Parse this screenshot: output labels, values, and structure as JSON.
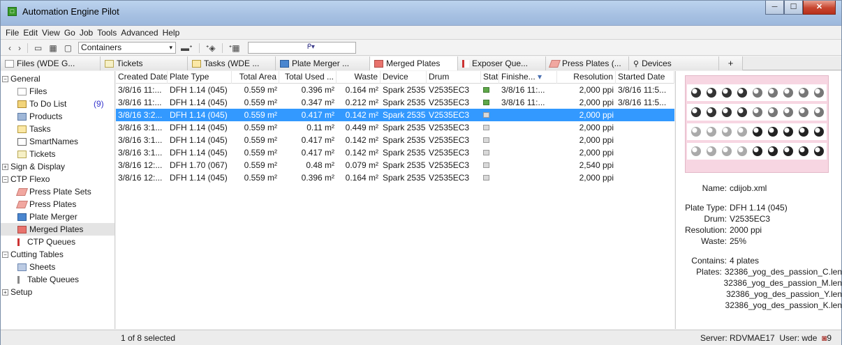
{
  "window": {
    "title": "Automation Engine Pilot",
    "app_icon_glyph": "□"
  },
  "window_buttons": {
    "minimize": "─",
    "maximize": "☐",
    "close": "✕"
  },
  "menubar": [
    "File",
    "Edit",
    "View",
    "Go",
    "Job",
    "Tools",
    "Advanced",
    "Help"
  ],
  "toolbar": {
    "back": "‹",
    "forward": "›",
    "view_list": "▭",
    "view_grid": "▦",
    "view_detail": "▢",
    "containers_label": "Containers",
    "dropdown_arrow": "▾",
    "action1": "▬ᐩ",
    "action2": "ᐩ◈",
    "action3": "ᐩ▦",
    "search_value": "",
    "search_icon": "ᑭ▾"
  },
  "tabs": [
    {
      "label": "Files (WDE G...",
      "icon": "files-icon"
    },
    {
      "label": "Tickets",
      "icon": "ticket-icon"
    },
    {
      "label": "Tasks (WDE ...",
      "icon": "task-icon"
    },
    {
      "label": "Plate Merger ...",
      "icon": "plate-merger-icon"
    },
    {
      "label": "Merged Plates",
      "icon": "merged-plates-icon"
    },
    {
      "label": "Exposer Que...",
      "icon": "exposer-queue-icon"
    },
    {
      "label": "Press Plates (...",
      "icon": "press-plates-icon"
    },
    {
      "label": "Devices",
      "icon": "device-icon"
    }
  ],
  "tab_plus": "+",
  "sidebar": {
    "expanders": {
      "open": "−",
      "closed": "+"
    },
    "general": {
      "label": "General",
      "items": [
        "Files",
        "To Do List",
        "Products",
        "Tasks",
        "SmartNames",
        "Tickets"
      ],
      "todo_badge": "(9)"
    },
    "sign_display": "Sign & Display",
    "ctp_flexo": {
      "label": "CTP Flexo",
      "items": [
        "Press Plate Sets",
        "Press Plates",
        "Plate Merger",
        "Merged Plates",
        "CTP Queues"
      ]
    },
    "cutting_tables": {
      "label": "Cutting Tables",
      "items": [
        "Sheets",
        "Table Queues"
      ]
    },
    "setup": "Setup"
  },
  "table": {
    "headers": [
      "Created Date",
      "Plate Type",
      "Total Area",
      "Total Used ...",
      "Waste",
      "Device",
      "Drum",
      "State",
      "Finishe...",
      "Resolution",
      "Started Date"
    ],
    "sort_indicator": "▾",
    "rows": [
      [
        "3/8/16 11:...",
        "DFH 1.14 (045)",
        "0.559 m²",
        "0.396 m²",
        "0.164 m²",
        "Spark 2535",
        "V2535EC3",
        "green",
        "3/8/16 11:...",
        "2,000 ppi",
        "3/8/16 11:5..."
      ],
      [
        "3/8/16 11:...",
        "DFH 1.14 (045)",
        "0.559 m²",
        "0.347 m²",
        "0.212 m²",
        "Spark 2535",
        "V2535EC3",
        "green",
        "3/8/16 11:...",
        "2,000 ppi",
        "3/8/16 11:5..."
      ],
      [
        "3/8/16 3:2...",
        "DFH 1.14 (045)",
        "0.559 m²",
        "0.417 m²",
        "0.142 m²",
        "Spark 2535",
        "V2535EC3",
        "grey",
        "",
        "2,000 ppi",
        ""
      ],
      [
        "3/8/16 3:1...",
        "DFH 1.14 (045)",
        "0.559 m²",
        "0.11 m²",
        "0.449 m²",
        "Spark 2535",
        "V2535EC3",
        "grey",
        "",
        "2,000 ppi",
        ""
      ],
      [
        "3/8/16 3:1...",
        "DFH 1.14 (045)",
        "0.559 m²",
        "0.417 m²",
        "0.142 m²",
        "Spark 2535",
        "V2535EC3",
        "grey",
        "",
        "2,000 ppi",
        ""
      ],
      [
        "3/8/16 3:1...",
        "DFH 1.14 (045)",
        "0.559 m²",
        "0.417 m²",
        "0.142 m²",
        "Spark 2535",
        "V2535EC3",
        "grey",
        "",
        "2,000 ppi",
        ""
      ],
      [
        "3/8/16 12:...",
        "DFH 1.70 (067)",
        "0.559 m²",
        "0.48 m²",
        "0.079 m²",
        "Spark 2535",
        "V2535EC3",
        "grey",
        "",
        "2,540 ppi",
        ""
      ],
      [
        "3/8/16 12:...",
        "DFH 1.14 (045)",
        "0.559 m²",
        "0.396 m²",
        "0.164 m²",
        "Spark 2535",
        "V2535EC3",
        "grey",
        "",
        "2,000 ppi",
        ""
      ]
    ],
    "selected_row": 2
  },
  "details": {
    "name_label": "Name:",
    "name": "cdijob.xml",
    "plate_type_label": "Plate Type:",
    "plate_type": "DFH 1.14 (045)",
    "drum_label": "Drum:",
    "drum": "V2535EC3",
    "resolution_label": "Resolution:",
    "resolution": "2000 ppi",
    "waste_label": "Waste:",
    "waste": "25%",
    "contains_label": "Contains:",
    "contains": "4 plates",
    "plates_label": "Plates:",
    "plates": [
      "32386_yog_des_passion_C.len",
      "32386_yog_des_passion_M.len",
      "32386_yog_des_passion_Y.len",
      "32386_yog_des_passion_K.len"
    ]
  },
  "status": {
    "selection": "1 of 8 selected",
    "server_label": "Server:",
    "server": "RDVMAE17",
    "user_label": "User:",
    "user": "wde",
    "notify_icon": "◙",
    "notify_count": "9"
  },
  "colors": {
    "selection": "#3399ff",
    "preview_bg": "#f7d6e2",
    "state_done": "#5fa84a",
    "state_idle": "#d9d9d9"
  }
}
